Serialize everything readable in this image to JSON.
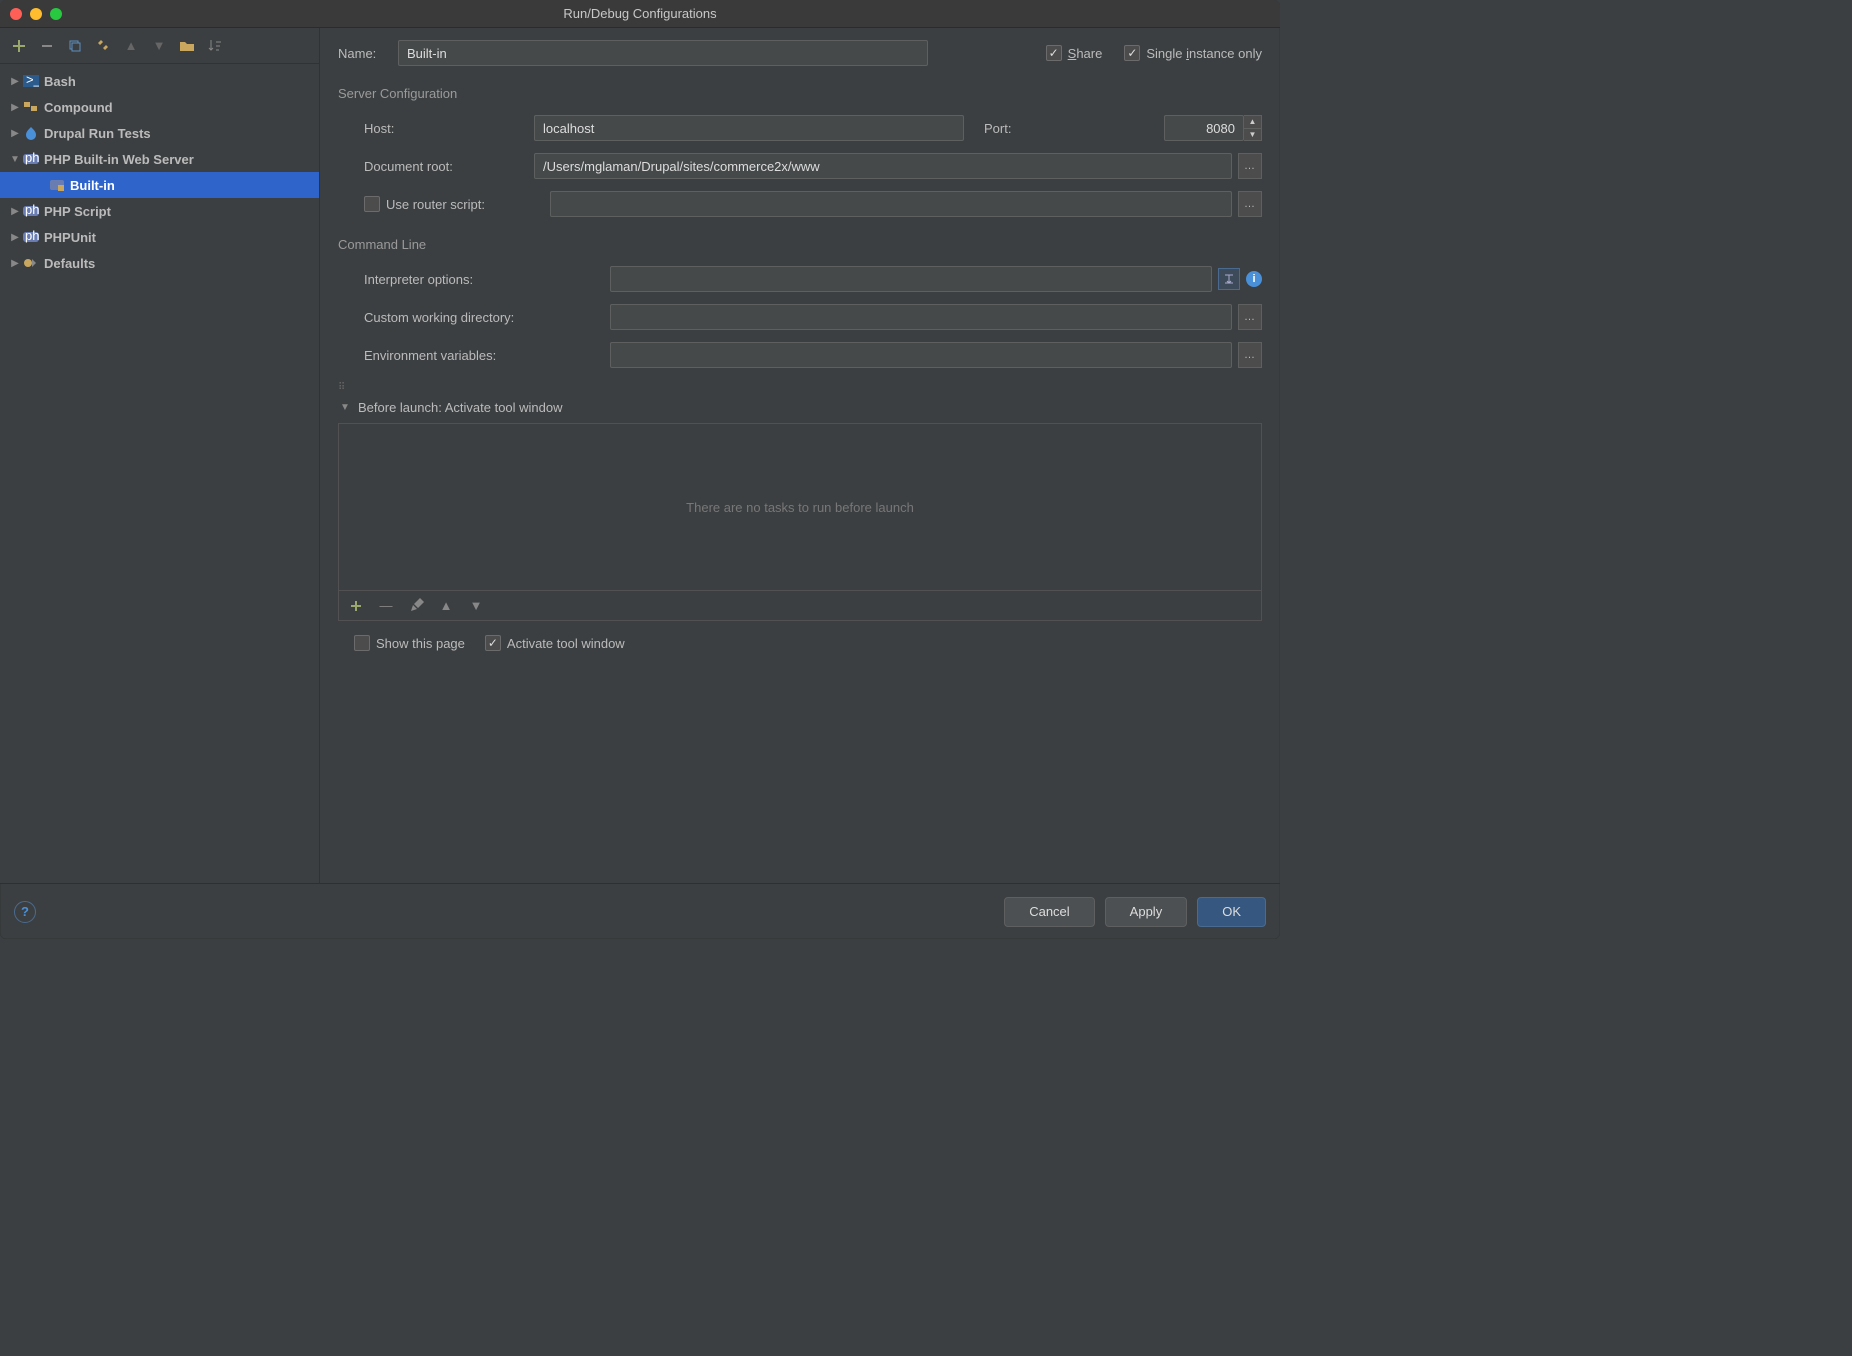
{
  "title": "Run/Debug Configurations",
  "tree": [
    {
      "label": "Bash",
      "expanded": false
    },
    {
      "label": "Compound",
      "expanded": false
    },
    {
      "label": "Drupal Run Tests",
      "expanded": false
    },
    {
      "label": "PHP Built-in Web Server",
      "expanded": true,
      "children": [
        {
          "label": "Built-in",
          "selected": true
        }
      ]
    },
    {
      "label": "PHP Script",
      "expanded": false
    },
    {
      "label": "PHPUnit",
      "expanded": false
    },
    {
      "label": "Defaults",
      "expanded": false
    }
  ],
  "name_label": "Name:",
  "name_value": "Built-in",
  "share_label": "Share",
  "single_instance_label": "Single instance only",
  "share_checked": true,
  "single_instance_checked": true,
  "section_server": "Server Configuration",
  "host_label": "Host:",
  "host_value": "localhost",
  "port_label": "Port:",
  "port_value": "8080",
  "docroot_label": "Document root:",
  "docroot_value": "/Users/mglaman/Drupal/sites/commerce2x/www",
  "router_label": "Use router script:",
  "router_value": "",
  "router_checked": false,
  "section_cmd": "Command Line",
  "interp_label": "Interpreter options:",
  "interp_value": "",
  "cwd_label": "Custom working directory:",
  "cwd_value": "",
  "env_label": "Environment variables:",
  "env_value": "",
  "before_launch_label": "Before launch: Activate tool window",
  "before_launch_empty": "There are no tasks to run before launch",
  "show_page_label": "Show this page",
  "show_page_checked": false,
  "activate_tool_label": "Activate tool window",
  "activate_tool_checked": true,
  "cancel_label": "Cancel",
  "apply_label": "Apply",
  "ok_label": "OK"
}
